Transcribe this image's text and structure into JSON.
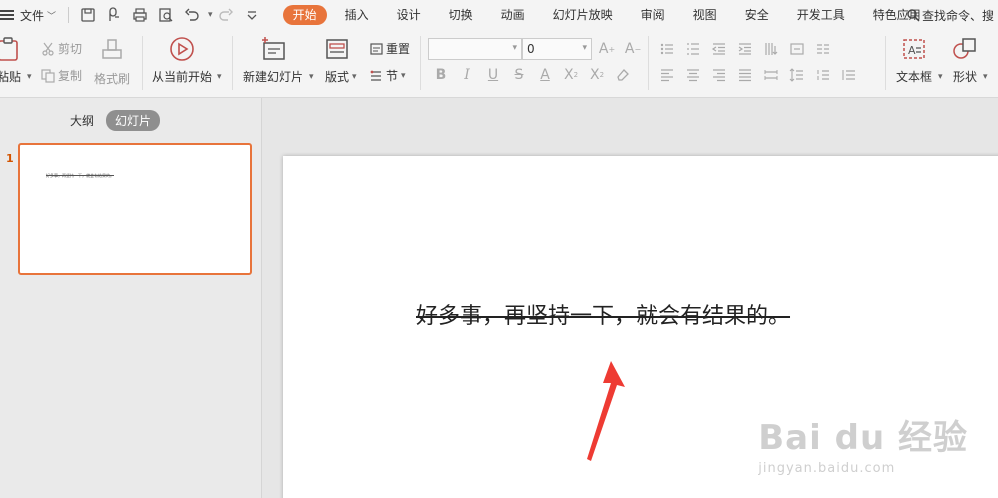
{
  "menubar": {
    "file_label": "文件",
    "tabs": [
      {
        "label": "开始",
        "active": true
      },
      {
        "label": "插入",
        "active": false
      },
      {
        "label": "设计",
        "active": false
      },
      {
        "label": "切换",
        "active": false
      },
      {
        "label": "动画",
        "active": false
      },
      {
        "label": "幻灯片放映",
        "active": false
      },
      {
        "label": "审阅",
        "active": false
      },
      {
        "label": "视图",
        "active": false
      },
      {
        "label": "安全",
        "active": false
      },
      {
        "label": "开发工具",
        "active": false
      },
      {
        "label": "特色应用",
        "active": false
      }
    ],
    "search_label": "查找命令、搜",
    "accent_color": "#e8743b"
  },
  "ribbon": {
    "paste": "粘贴",
    "cut": "剪切",
    "copy": "复制",
    "format_painter": "格式刷",
    "from_current": "从当前开始",
    "new_slide": "新建幻灯片",
    "layout": "版式",
    "reset": "重置",
    "section": "节",
    "font_size_value": "0",
    "textbox": "文本框",
    "shape": "形状"
  },
  "leftpanel": {
    "outline_tab": "大纲",
    "slides_tab": "幻灯片",
    "slide_number": "1",
    "thumb_text": "好多事，再坚持一下，就会有结果的。"
  },
  "slide": {
    "text": "好多事，再坚持一下，就会有结果的。"
  },
  "watermark": {
    "logo": "Bai du 经验",
    "url": "jingyan.baidu.com"
  }
}
